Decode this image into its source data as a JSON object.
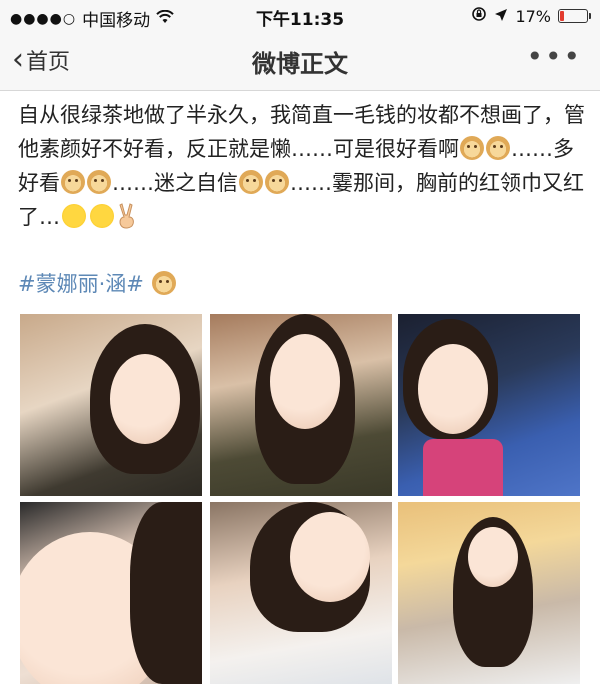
{
  "status_bar": {
    "signal_dots": "●●●●○",
    "carrier": "中国移动",
    "wifi_icon": "wifi-icon",
    "time": "下午11:35",
    "battery_percent": "17%",
    "battery_level": 0.17,
    "battery_color": "#e23b2e"
  },
  "nav": {
    "back_label": "首页",
    "title": "微博正文",
    "more_label": "•••"
  },
  "post": {
    "segments": [
      {
        "type": "text",
        "value": "自从很绿茶地做了半永久，我简直一毛钱的妆都不想画了，管他素颜好不好看，反正就是懒……可是很好看啊"
      },
      {
        "type": "emoji",
        "name": "doge-emoji"
      },
      {
        "type": "emoji",
        "name": "doge-emoji"
      },
      {
        "type": "text",
        "value": "……多好看"
      },
      {
        "type": "emoji",
        "name": "doge-emoji"
      },
      {
        "type": "emoji",
        "name": "doge-emoji"
      },
      {
        "type": "text",
        "value": "……迷之自信"
      },
      {
        "type": "emoji",
        "name": "doge-emoji"
      },
      {
        "type": "emoji",
        "name": "doge-emoji"
      },
      {
        "type": "text",
        "value": "……霎那间，胸前的红领巾又红了…"
      },
      {
        "type": "emoji",
        "name": "smile-emoji"
      },
      {
        "type": "emoji",
        "name": "smile-emoji"
      },
      {
        "type": "emoji",
        "name": "victory-hand-emoji"
      }
    ],
    "hashtag": "#蒙娜丽·涵#",
    "hashtag_color": "#5d88b6"
  },
  "photos": [
    {
      "name": "photo-1"
    },
    {
      "name": "photo-2"
    },
    {
      "name": "photo-3"
    },
    {
      "name": "photo-4"
    },
    {
      "name": "photo-5"
    },
    {
      "name": "photo-6"
    }
  ]
}
